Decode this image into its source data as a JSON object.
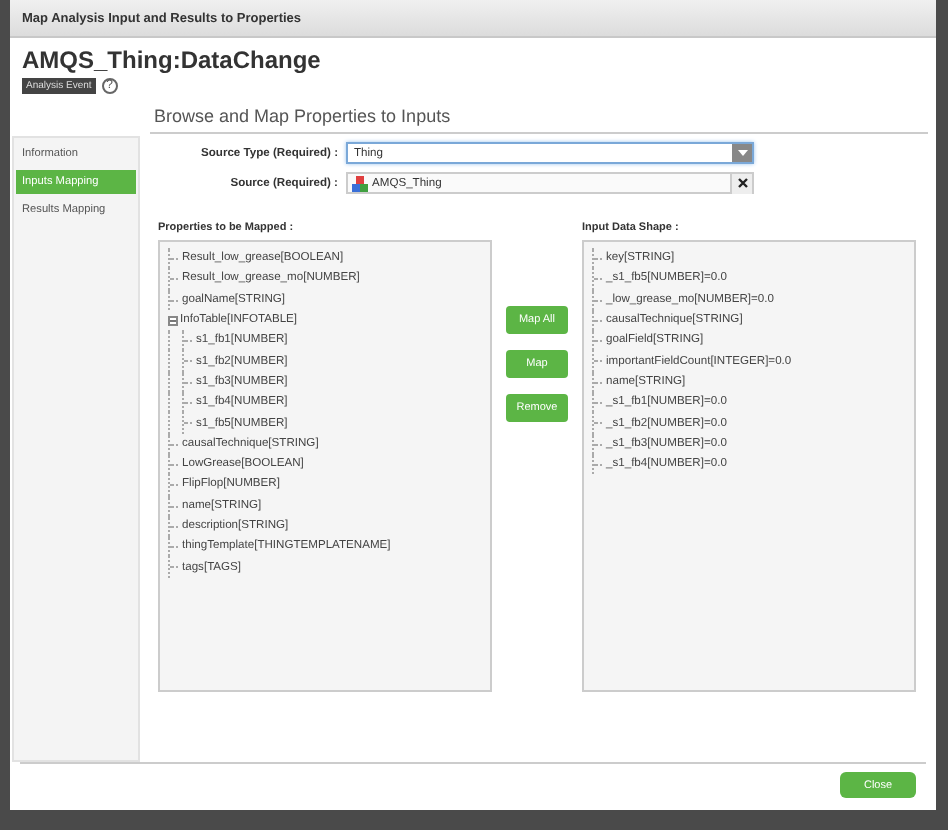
{
  "window": {
    "title": "Map Analysis Input and Results to Properties"
  },
  "header": {
    "title": "AMQS_Thing:DataChange",
    "badge": "Analysis Event",
    "help": "?"
  },
  "sidebar": {
    "items": [
      {
        "label": "Information",
        "selected": false
      },
      {
        "label": "Inputs Mapping",
        "selected": true
      },
      {
        "label": "Results Mapping",
        "selected": false
      }
    ]
  },
  "section_title": "Browse and Map Properties to Inputs",
  "source_type": {
    "label": "Source Type (Required) :",
    "value": "Thing"
  },
  "source": {
    "label": "Source (Required) :",
    "value": "AMQS_Thing"
  },
  "properties": {
    "label": "Properties to be Mapped :",
    "items": [
      {
        "label": "Result_low_grease[BOOLEAN]"
      },
      {
        "label": "Result_low_grease_mo[NUMBER]"
      },
      {
        "label": "goalName[STRING]"
      },
      {
        "label": "InfoTable[INFOTABLE]",
        "expanded": true,
        "children": [
          {
            "label": "s1_fb1[NUMBER]"
          },
          {
            "label": "s1_fb2[NUMBER]"
          },
          {
            "label": "s1_fb3[NUMBER]"
          },
          {
            "label": "s1_fb4[NUMBER]"
          },
          {
            "label": "s1_fb5[NUMBER]"
          }
        ]
      },
      {
        "label": "causalTechnique[STRING]"
      },
      {
        "label": "LowGrease[BOOLEAN]"
      },
      {
        "label": "FlipFlop[NUMBER]"
      },
      {
        "label": "name[STRING]"
      },
      {
        "label": "description[STRING]"
      },
      {
        "label": "thingTemplate[THINGTEMPLATENAME]"
      },
      {
        "label": "tags[TAGS]"
      }
    ]
  },
  "actions": [
    "Map All",
    "Map",
    "Remove"
  ],
  "input_shape": {
    "label": "Input Data Shape :",
    "items": [
      {
        "label": "key[STRING]"
      },
      {
        "label": "_s1_fb5[NUMBER]=0.0"
      },
      {
        "label": "_low_grease_mo[NUMBER]=0.0"
      },
      {
        "label": "causalTechnique[STRING]"
      },
      {
        "label": "goalField[STRING]"
      },
      {
        "label": "importantFieldCount[INTEGER]=0.0"
      },
      {
        "label": "name[STRING]"
      },
      {
        "label": "_s1_fb1[NUMBER]=0.0"
      },
      {
        "label": "_s1_fb2[NUMBER]=0.0"
      },
      {
        "label": "_s1_fb3[NUMBER]=0.0"
      },
      {
        "label": "_s1_fb4[NUMBER]=0.0"
      }
    ]
  },
  "footer": {
    "button": "Close"
  }
}
